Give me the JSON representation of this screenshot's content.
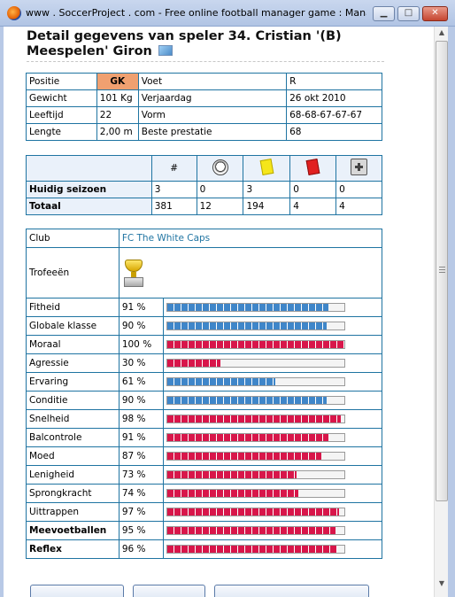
{
  "window": {
    "title": "www . SoccerProject . com - Free online football manager game : Mana...",
    "minimize_label": "▁",
    "maximize_label": "□",
    "close_label": "✕"
  },
  "page": {
    "title": "Detail gegevens van speler 34. Cristian '(B) Meespelen' Giron"
  },
  "info": {
    "rows": [
      [
        "Positie",
        "GK",
        "Voet",
        "R"
      ],
      [
        "Gewicht",
        "101 Kg",
        "Verjaardag",
        "26 okt 2010"
      ],
      [
        "Leeftijd",
        "22",
        "Vorm",
        "68-68-67-67-67"
      ],
      [
        "Lengte",
        "2,00 m",
        "Beste prestatie",
        "68"
      ]
    ]
  },
  "season": {
    "headers": [
      "#",
      "goals-icon",
      "yellow-card-icon",
      "red-card-icon",
      "injury-icon"
    ],
    "hash_label": "#",
    "rows": [
      {
        "label": "Huidig seizoen",
        "values": [
          "3",
          "0",
          "3",
          "0",
          "0"
        ]
      },
      {
        "label": "Totaal",
        "values": [
          "381",
          "12",
          "194",
          "4",
          "4"
        ]
      }
    ]
  },
  "club": {
    "label": "Club",
    "name": "FC The White Caps"
  },
  "trophies": {
    "label": "Trofeeën",
    "icon": "trophy-icon"
  },
  "skills": [
    {
      "label": "Fitheid",
      "value": "91 %",
      "pct": 91,
      "color": "blue",
      "bold": false
    },
    {
      "label": "Globale klasse",
      "value": "90 %",
      "pct": 90,
      "color": "blue",
      "bold": false
    },
    {
      "label": "Moraal",
      "value": "100 %",
      "pct": 100,
      "color": "red",
      "bold": false
    },
    {
      "label": "Agressie",
      "value": "30 %",
      "pct": 30,
      "color": "red",
      "bold": false
    },
    {
      "label": "Ervaring",
      "value": "61 %",
      "pct": 61,
      "color": "blue",
      "bold": false
    },
    {
      "label": "Conditie",
      "value": "90 %",
      "pct": 90,
      "color": "blue",
      "bold": false
    },
    {
      "label": "Snelheid",
      "value": "98 %",
      "pct": 98,
      "color": "red",
      "bold": false
    },
    {
      "label": "Balcontrole",
      "value": "91 %",
      "pct": 91,
      "color": "red",
      "bold": false
    },
    {
      "label": "Moed",
      "value": "87 %",
      "pct": 87,
      "color": "red",
      "bold": false
    },
    {
      "label": "Lenigheid",
      "value": "73 %",
      "pct": 73,
      "color": "red",
      "bold": false
    },
    {
      "label": "Sprongkracht",
      "value": "74 %",
      "pct": 74,
      "color": "red",
      "bold": false
    },
    {
      "label": "Uittrappen",
      "value": "97 %",
      "pct": 97,
      "color": "red",
      "bold": false
    },
    {
      "label": "Meevoetballen",
      "value": "95 %",
      "pct": 95,
      "color": "red",
      "bold": true
    },
    {
      "label": "Reflex",
      "value": "96 %",
      "pct": 96,
      "color": "red",
      "bold": true
    }
  ],
  "colors": {
    "blue": "#3f86c9",
    "red": "#d8164a",
    "border": "#1f74a2",
    "gk_highlight": "#f0a070"
  }
}
